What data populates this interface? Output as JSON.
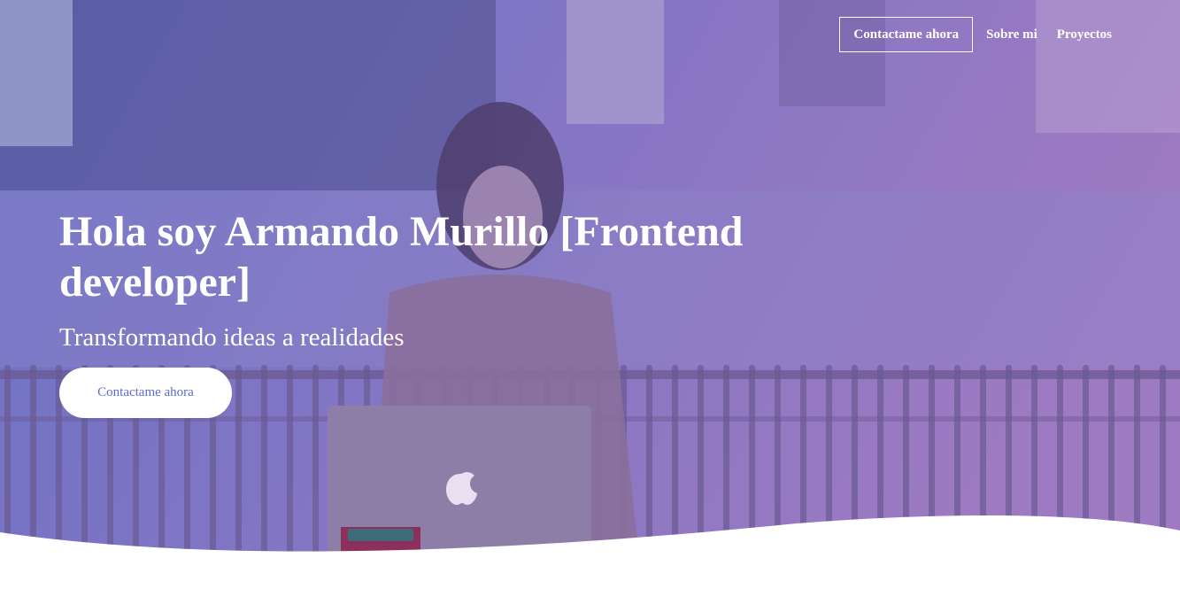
{
  "nav": {
    "items": [
      {
        "label": "Contactame ahora"
      },
      {
        "label": "Sobre mi"
      },
      {
        "label": "Proyectos"
      }
    ]
  },
  "hero": {
    "title": "Hola soy Armando Murillo [Frontend developer]",
    "subtitle": "Transformando ideas a realidades",
    "cta_label": "Contactame ahora"
  },
  "colors": {
    "overlay_start": "#6f74c9",
    "overlay_end": "#9a78c4",
    "button_text": "#5b6bd6"
  }
}
